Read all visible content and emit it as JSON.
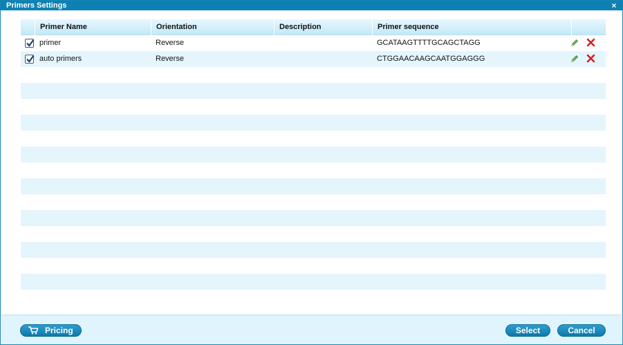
{
  "dialog": {
    "title": "Primers Settings",
    "close_label": "×"
  },
  "table": {
    "columns": [
      "Primer Name",
      "Orientation",
      "Description",
      "Primer sequence"
    ],
    "rows": [
      {
        "checked": true,
        "name": "primer",
        "orientation": "Reverse",
        "description": "",
        "sequence": "GCATAAGTTTTGCAGCTAGG"
      },
      {
        "checked": true,
        "name": "auto primers",
        "orientation": "Reverse",
        "description": "",
        "sequence": "CTGGAACAAGCAATGGAGGG"
      }
    ],
    "empty_rows": 15
  },
  "footer": {
    "pricing_label": "Pricing",
    "select_label": "Select",
    "cancel_label": "Cancel"
  },
  "colors": {
    "titlebar": "#0d81b4",
    "row_alt": "#e4f5fc",
    "button": "#1589bd",
    "edit_icon": "#3a9a3a",
    "delete_icon": "#d42020"
  },
  "icons": {
    "close": "close-icon",
    "checkbox": "checkmark-icon",
    "edit": "pencil-icon",
    "delete": "x-delete-icon",
    "cart": "cart-icon"
  }
}
